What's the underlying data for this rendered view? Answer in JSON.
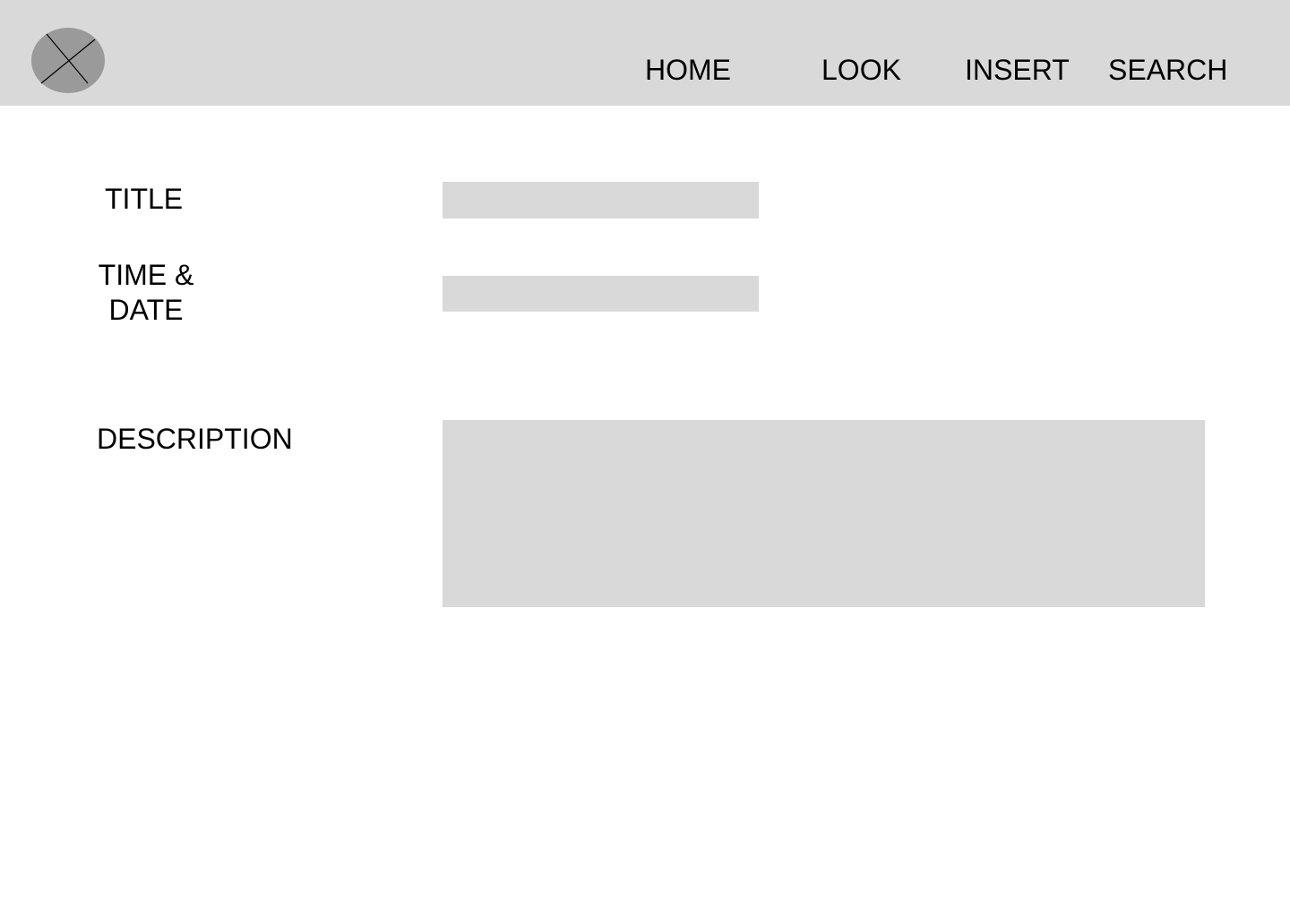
{
  "header": {
    "logo_icon": "image-placeholder-icon",
    "nav": {
      "home": "HOME",
      "look": "LOOK",
      "insert": "INSERT",
      "search": "SEARCH"
    }
  },
  "form": {
    "title": {
      "label": "TITLE",
      "value": "",
      "placeholder": ""
    },
    "datetime": {
      "label": "TIME & DATE",
      "value": "",
      "placeholder": ""
    },
    "description": {
      "label": "DESCRIPTION",
      "value": "",
      "placeholder": ""
    }
  },
  "colors": {
    "bar_background": "#d9d9d9",
    "field_background": "#d9d9d9",
    "logo_fill": "#9a9a9a",
    "text": "#000000"
  }
}
